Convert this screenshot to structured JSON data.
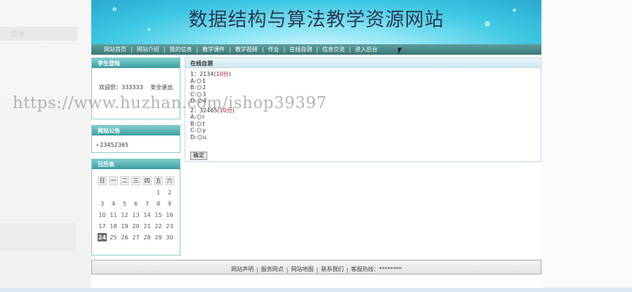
{
  "site": {
    "title": "数据结构与算法教学资源网站"
  },
  "nav": {
    "items": [
      "网站首页",
      "网站介绍",
      "我的信息",
      "教学课件",
      "教学视频",
      "作业",
      "在线自测",
      "信息交流",
      "进入后台"
    ],
    "separator": "|"
  },
  "login_box": {
    "title": "学生登陆",
    "welcome": "欢迎您：333333",
    "logout": "安全退出"
  },
  "notice_box": {
    "title": "网站公告",
    "bullet": "›",
    "item": "23452365"
  },
  "calendar": {
    "title": "日历表",
    "weekdays": [
      "日",
      "一",
      "二",
      "三",
      "四",
      "五",
      "六"
    ],
    "weeks": [
      [
        "",
        "",
        "",
        "",
        "",
        "1",
        "2"
      ],
      [
        "3",
        "4",
        "5",
        "6",
        "7",
        "8",
        "9"
      ],
      [
        "10",
        "11",
        "12",
        "13",
        "14",
        "15",
        "16"
      ],
      [
        "17",
        "18",
        "19",
        "20",
        "21",
        "22",
        "23"
      ],
      [
        "24",
        "25",
        "26",
        "27",
        "28",
        "29",
        "30"
      ]
    ],
    "today": "24"
  },
  "test": {
    "title": "在线自测",
    "questions": [
      {
        "prefix": "1：2134(",
        "score": "10分",
        "suffix": ")",
        "options": [
          {
            "label": "A:",
            "text": "1"
          },
          {
            "label": "B:",
            "text": "2"
          },
          {
            "label": "C:",
            "text": "3"
          },
          {
            "label": "D:",
            "text": "4"
          }
        ]
      },
      {
        "prefix": "2：32465(",
        "score": "10分",
        "suffix": ")",
        "options": [
          {
            "label": "A:",
            "text": "r"
          },
          {
            "label": "B:",
            "text": "t"
          },
          {
            "label": "C:",
            "text": "y"
          },
          {
            "label": "D:",
            "text": "u"
          }
        ]
      }
    ],
    "submit_label": "确定"
  },
  "footer": {
    "items": [
      "网站声明",
      "服务网点",
      "网站地图",
      "联系我们",
      "客服热线：********"
    ],
    "separator": "|"
  },
  "watermark": "https://www.huzhan.com/ishop39397",
  "left_ghost": "菜单",
  "colors": {
    "nav_bg": "#3a7878",
    "box_header": "#3d9e9e",
    "score_red": "#d01010"
  }
}
